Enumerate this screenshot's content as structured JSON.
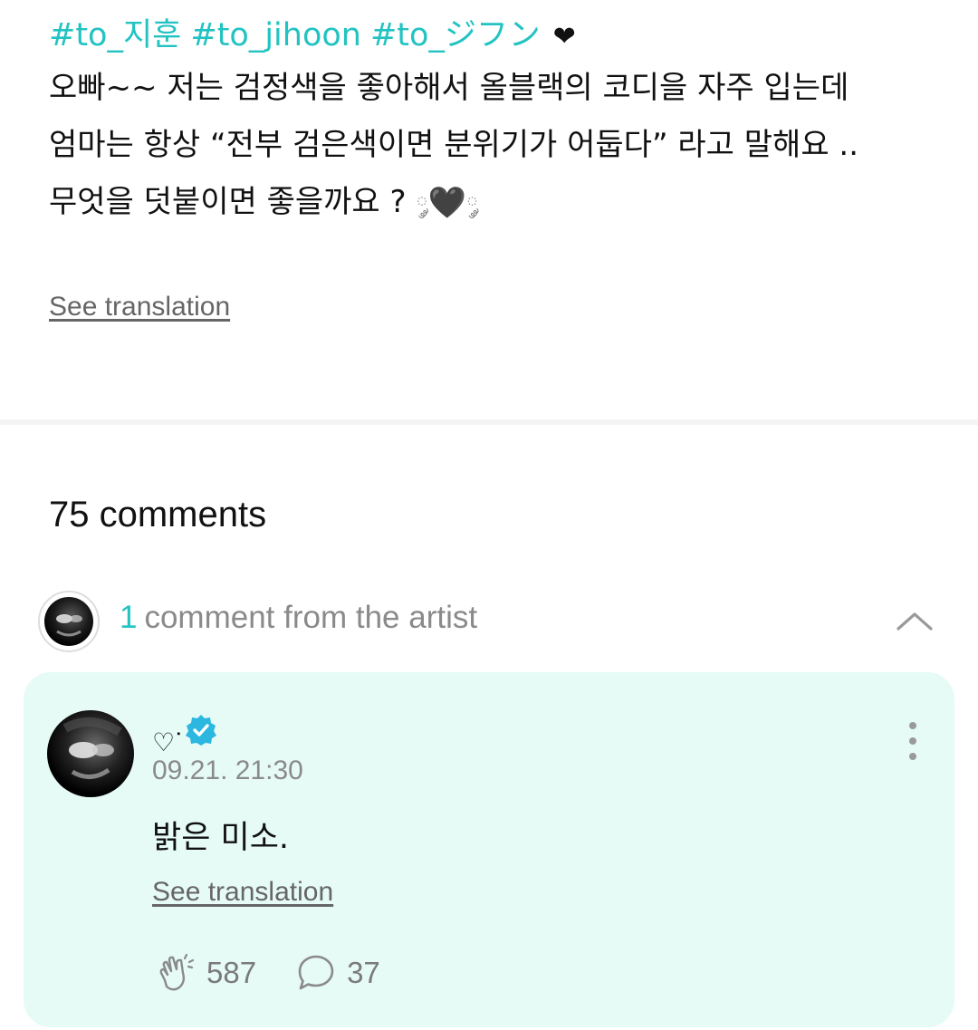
{
  "post": {
    "hashtags": [
      "#to_지훈",
      "#to_jihoon",
      "#to_ジフン"
    ],
    "heart_glyph": "❤",
    "lines": [
      "오빠~~ 저는 검정색을 좋아해서 올블랙의 코디을 자주 입는데",
      "엄마는 항상 “전부 검은색이면 분위기가 어둡다” 라고 말해요 ..",
      "무엇을 덧붙이면 좋을까요 ?"
    ],
    "emoji_wing_left": "༘",
    "emoji_heart": "🖤",
    "emoji_wing_right": "༘",
    "see_translation": "See translation"
  },
  "comments_header": {
    "title": "75 comments"
  },
  "artist_section": {
    "count": "1",
    "label": "comment from the artist",
    "collapse_icon": "chevron-up-icon"
  },
  "artist_comment": {
    "name": "♡ᐝ",
    "verified_icon": "verified-badge-icon",
    "timestamp": "09.21. 21:30",
    "text": "밝은 미소.",
    "see_translation": "See translation",
    "more_icon": "more-vertical-icon",
    "likes_icon": "applause-icon",
    "likes": "587",
    "replies_icon": "comment-bubble-icon",
    "replies": "37"
  },
  "colors": {
    "accent": "#22c3c2",
    "card_background": "#e6fbf6",
    "verified": "#2bb7e0",
    "muted_text": "#8a8a8a"
  }
}
